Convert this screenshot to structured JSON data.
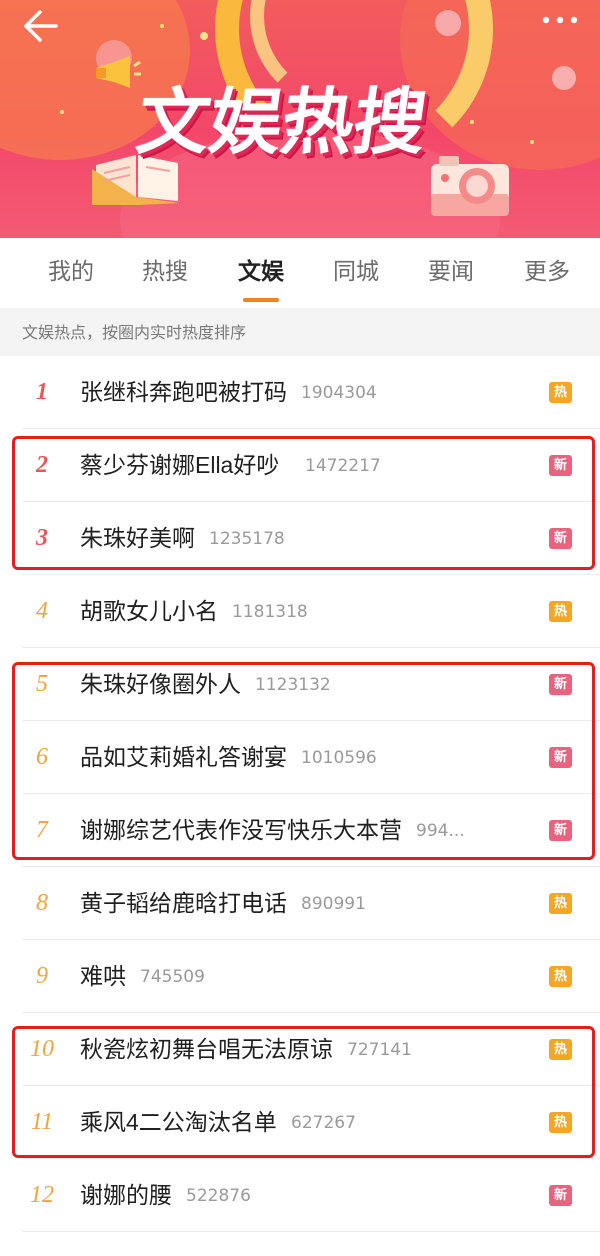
{
  "colors": {
    "accent": "#f0831e",
    "hot": "#f5a623",
    "new": "#e9637f",
    "rank_top": "#e6585a",
    "rank_other": "#f3a33a",
    "highlight_box": "#e0201b"
  },
  "header": {
    "title": "文娱热搜",
    "back_icon": "back-arrow-icon",
    "more_icon": "more-dots-icon"
  },
  "tabs": [
    {
      "label": "我的",
      "active": false
    },
    {
      "label": "热搜",
      "active": false
    },
    {
      "label": "文娱",
      "active": true
    },
    {
      "label": "同城",
      "active": false
    },
    {
      "label": "要闻",
      "active": false
    },
    {
      "label": "更多",
      "active": false
    }
  ],
  "subheader": "文娱热点，按圈内实时热度排序",
  "items": [
    {
      "rank": "1",
      "title": "张继科奔跑吧被打码",
      "count": "1904304",
      "badge": "热",
      "badge_type": "hot"
    },
    {
      "rank": "2",
      "title": "蔡少芬谢娜Ella好吵",
      "count": "1472217",
      "badge": "新",
      "badge_type": "new"
    },
    {
      "rank": "3",
      "title": "朱珠好美啊",
      "count": "1235178",
      "badge": "新",
      "badge_type": "new"
    },
    {
      "rank": "4",
      "title": "胡歌女儿小名",
      "count": "1181318",
      "badge": "热",
      "badge_type": "hot"
    },
    {
      "rank": "5",
      "title": "朱珠好像圈外人",
      "count": "1123132",
      "badge": "新",
      "badge_type": "new"
    },
    {
      "rank": "6",
      "title": "品如艾莉婚礼答谢宴",
      "count": "1010596",
      "badge": "新",
      "badge_type": "new"
    },
    {
      "rank": "7",
      "title": "谢娜综艺代表作没写快乐大本营",
      "count": "994...",
      "badge": "新",
      "badge_type": "new"
    },
    {
      "rank": "8",
      "title": "黄子韬给鹿晗打电话",
      "count": "890991",
      "badge": "热",
      "badge_type": "hot"
    },
    {
      "rank": "9",
      "title": "难哄",
      "count": "745509",
      "badge": "热",
      "badge_type": "hot"
    },
    {
      "rank": "10",
      "title": "秋瓷炫初舞台唱无法原谅",
      "count": "727141",
      "badge": "热",
      "badge_type": "hot"
    },
    {
      "rank": "11",
      "title": "乘风4二公淘汰名单",
      "count": "627267",
      "badge": "热",
      "badge_type": "hot"
    },
    {
      "rank": "12",
      "title": "谢娜的腰",
      "count": "522876",
      "badge": "新",
      "badge_type": "new"
    }
  ],
  "highlight_groups": [
    {
      "ranks": [
        "2",
        "3"
      ]
    },
    {
      "ranks": [
        "5",
        "6",
        "7"
      ]
    },
    {
      "ranks": [
        "10",
        "11"
      ]
    }
  ]
}
